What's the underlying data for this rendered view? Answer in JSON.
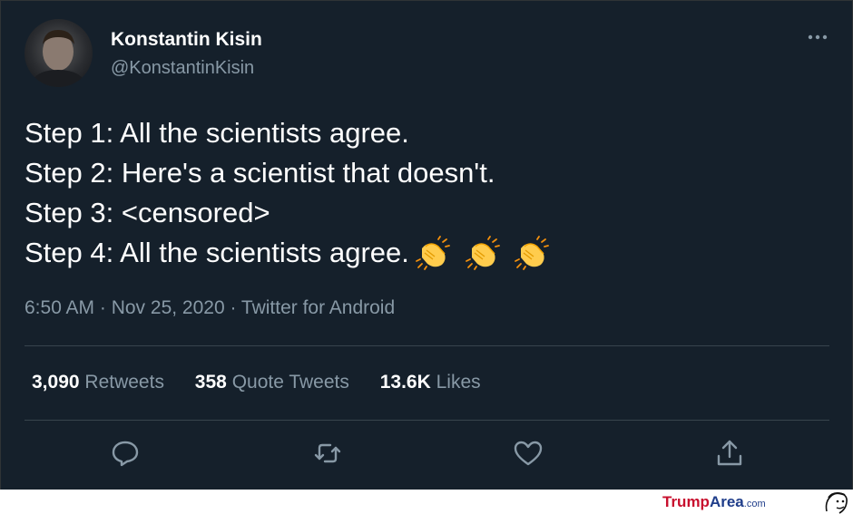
{
  "tweet": {
    "author_name": "Konstantin Kisin",
    "author_handle": "@KonstantinKisin",
    "lines": [
      "Step 1: All the scientists agree.",
      "Step 2: Here's a scientist that doesn't.",
      "Step 3: <censored>",
      "Step 4: All the scientists agree."
    ],
    "emoji": [
      "clapping-hands",
      "clapping-hands",
      "clapping-hands"
    ],
    "meta": "6:50 AM · Nov 25, 2020 · Twitter for Android"
  },
  "stats": [
    {
      "value": "3,090",
      "label": "Retweets"
    },
    {
      "value": "358",
      "label": "Quote Tweets"
    },
    {
      "value": "13.6K",
      "label": "Likes"
    }
  ],
  "actions": [
    "reply-icon",
    "retweet-icon",
    "like-icon",
    "share-icon"
  ],
  "watermark": {
    "brand_part1": "Trump",
    "brand_part2": "Area",
    "brand_suffix": ".com"
  },
  "colors": {
    "background": "#15202b",
    "text": "#ffffff",
    "secondary_text": "#8899a6",
    "divider": "#38444d",
    "brand_red": "#c8102e",
    "brand_blue": "#1f3d8a"
  }
}
